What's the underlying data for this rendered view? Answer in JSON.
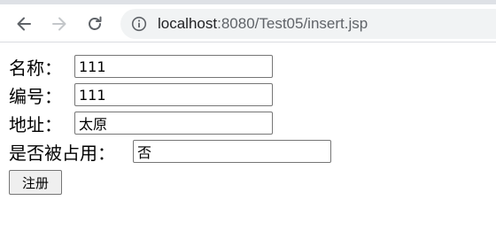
{
  "browser": {
    "url_host": "localhost",
    "url_rest": ":8080/Test05/insert.jsp",
    "icons": {
      "back": "arrow-left-icon",
      "forward": "arrow-right-icon",
      "reload": "reload-icon",
      "site_info": "info-icon"
    }
  },
  "form": {
    "name": {
      "label": "名称：",
      "value": "111"
    },
    "number": {
      "label": "编号：",
      "value": "111"
    },
    "address": {
      "label": "地址：",
      "value": "太原"
    },
    "occupied": {
      "label": "是否被占用：",
      "value": "否"
    },
    "submit_label": "注册"
  }
}
